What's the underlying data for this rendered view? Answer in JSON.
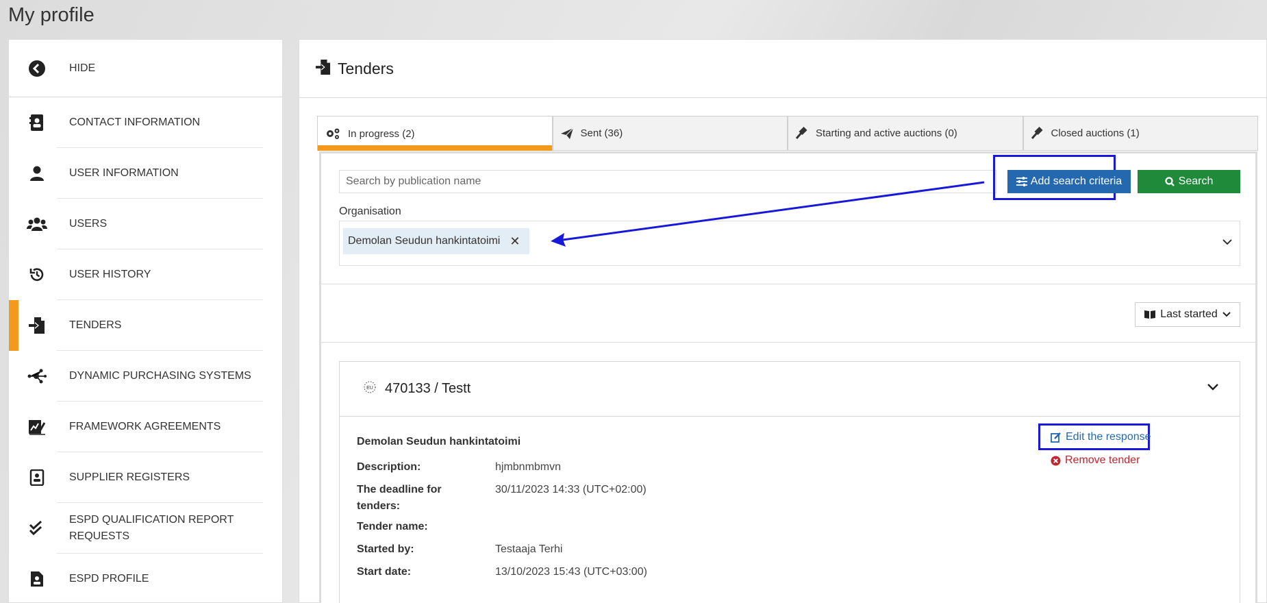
{
  "page_title": "My profile",
  "sidebar": {
    "hide_label": "HIDE",
    "items": [
      {
        "label": "CONTACT INFORMATION",
        "icon": "address-book-icon"
      },
      {
        "label": "USER INFORMATION",
        "icon": "user-icon"
      },
      {
        "label": "USERS",
        "icon": "users-icon"
      },
      {
        "label": "USER HISTORY",
        "icon": "history-icon"
      },
      {
        "label": "TENDERS",
        "icon": "tender-import-icon",
        "active": true
      },
      {
        "label": "DYNAMIC PURCHASING SYSTEMS",
        "icon": "network-icon"
      },
      {
        "label": "FRAMEWORK AGREEMENTS",
        "icon": "signature-chart-icon"
      },
      {
        "label": "SUPPLIER REGISTERS",
        "icon": "register-icon"
      },
      {
        "label": "ESPD QUALIFICATION REPORT REQUESTS",
        "icon": "double-check-icon"
      },
      {
        "label": "ESPD PROFILE",
        "icon": "file-user-icon"
      }
    ],
    "accent_color": "#f39a1e"
  },
  "main": {
    "title": "Tenders",
    "tabs": [
      {
        "label": "In progress (2)",
        "active": true
      },
      {
        "label": "Sent (36)"
      },
      {
        "label": "Starting and active auctions (0)"
      },
      {
        "label": "Closed auctions (1)"
      }
    ],
    "search": {
      "placeholder": "Search by publication name",
      "value": "",
      "add_criteria_label": "Add search criteria",
      "search_label": "Search"
    },
    "organisation": {
      "label": "Organisation",
      "selected": "Demolan Seudun hankintatoimi"
    },
    "sort": {
      "label": "Last started"
    },
    "tender": {
      "title": "470133 / Testt",
      "organisation": "Demolan Seudun hankintatoimi",
      "fields": [
        {
          "key": "Description:",
          "value": "hjmbnmbmvn"
        },
        {
          "key": "The deadline for tenders:",
          "value": "30/11/2023 14:33 (UTC+02:00)"
        },
        {
          "key": "Tender name:",
          "value": ""
        },
        {
          "key": "Started by:",
          "value": "Testaaja Terhi"
        },
        {
          "key": "Start date:",
          "value": "13/10/2023 15:43 (UTC+03:00)"
        }
      ],
      "edit_label": "Edit the response",
      "remove_label": "Remove tender"
    }
  },
  "colors": {
    "primary": "#2468b0",
    "success": "#1e8a3a",
    "danger": "#c0262d",
    "annotation": "#1818d8"
  }
}
